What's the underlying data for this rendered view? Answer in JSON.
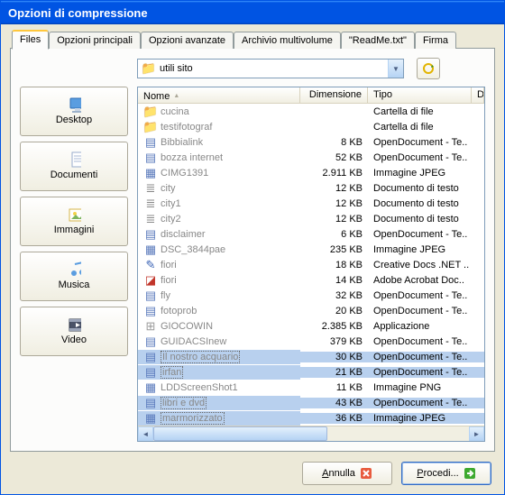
{
  "title": "Opzioni di compressione",
  "tabs": [
    {
      "label": "Files"
    },
    {
      "label": "Opzioni principali"
    },
    {
      "label": "Opzioni avanzate"
    },
    {
      "label": "Archivio multivolume"
    },
    {
      "label": "\"ReadMe.txt\""
    },
    {
      "label": "Firma"
    }
  ],
  "combo": {
    "text": "utili sito"
  },
  "sidebar": [
    {
      "label": "Desktop",
      "icon": "desktop"
    },
    {
      "label": "Documenti",
      "icon": "documents"
    },
    {
      "label": "Immagini",
      "icon": "images"
    },
    {
      "label": "Musica",
      "icon": "music"
    },
    {
      "label": "Video",
      "icon": "video"
    }
  ],
  "columns": {
    "name": "Nome",
    "dim": "Dimensione",
    "tipo": "Tipo",
    "last": "D"
  },
  "rows": [
    {
      "icon": "folder",
      "name": "cucina",
      "dim": "",
      "tipo": "Cartella di file",
      "sel": false
    },
    {
      "icon": "folder",
      "name": "testifotograf",
      "dim": "",
      "tipo": "Cartella di file",
      "sel": false
    },
    {
      "icon": "gen",
      "name": "Bibbialink",
      "dim": "8 KB",
      "tipo": "OpenDocument - Te..",
      "sel": false
    },
    {
      "icon": "gen",
      "name": "bozza internet",
      "dim": "52 KB",
      "tipo": "OpenDocument - Te..",
      "sel": false
    },
    {
      "icon": "img",
      "name": "CIMG1391",
      "dim": "2.911 KB",
      "tipo": "Immagine JPEG",
      "sel": false
    },
    {
      "icon": "txt",
      "name": "city",
      "dim": "12 KB",
      "tipo": "Documento di testo",
      "sel": false
    },
    {
      "icon": "txt",
      "name": "city1",
      "dim": "12 KB",
      "tipo": "Documento di testo",
      "sel": false
    },
    {
      "icon": "txt",
      "name": "city2",
      "dim": "12 KB",
      "tipo": "Documento di testo",
      "sel": false
    },
    {
      "icon": "gen",
      "name": "disclaimer",
      "dim": "6 KB",
      "tipo": "OpenDocument - Te..",
      "sel": false
    },
    {
      "icon": "img",
      "name": "DSC_3844pae",
      "dim": "235 KB",
      "tipo": "Immagine JPEG",
      "sel": false
    },
    {
      "icon": "doc",
      "name": "fiori",
      "dim": "18 KB",
      "tipo": "Creative Docs .NET ..",
      "sel": false
    },
    {
      "icon": "pdf",
      "name": "fiori",
      "dim": "14 KB",
      "tipo": "Adobe Acrobat Doc..",
      "sel": false
    },
    {
      "icon": "gen",
      "name": "fly",
      "dim": "32 KB",
      "tipo": "OpenDocument - Te..",
      "sel": false
    },
    {
      "icon": "gen",
      "name": "fotoprob",
      "dim": "20 KB",
      "tipo": "OpenDocument - Te..",
      "sel": false
    },
    {
      "icon": "app",
      "name": "GIOCOWIN",
      "dim": "2.385 KB",
      "tipo": "Applicazione",
      "sel": false
    },
    {
      "icon": "gen",
      "name": "GUIDACSInew",
      "dim": "379 KB",
      "tipo": "OpenDocument - Te..",
      "sel": false
    },
    {
      "icon": "gen",
      "name": "Il nostro acquario",
      "dim": "30 KB",
      "tipo": "OpenDocument - Te..",
      "sel": true
    },
    {
      "icon": "gen",
      "name": "irfan",
      "dim": "21 KB",
      "tipo": "OpenDocument - Te..",
      "sel": true
    },
    {
      "icon": "img",
      "name": "LDDScreenShot1",
      "dim": "11 KB",
      "tipo": "Immagine PNG",
      "sel": false
    },
    {
      "icon": "gen",
      "name": "libri e dvd",
      "dim": "43 KB",
      "tipo": "OpenDocument - Te..",
      "sel": true
    },
    {
      "icon": "img",
      "name": "marmorizzato",
      "dim": "36 KB",
      "tipo": "Immagine JPEG",
      "sel": true
    }
  ],
  "buttons": {
    "cancel": "nnulla",
    "cancel_u": "A",
    "proceed": "rocedi...",
    "proceed_u": "P"
  }
}
